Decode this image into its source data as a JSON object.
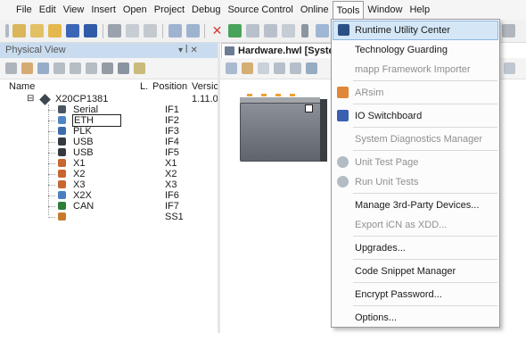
{
  "menu": {
    "items": [
      "File",
      "Edit",
      "View",
      "Insert",
      "Open",
      "Project",
      "Debug",
      "Source Control",
      "Online",
      "Tools",
      "Window",
      "Help"
    ],
    "active": "Tools"
  },
  "physical_view": {
    "title": "Physical View",
    "pin_glyph": "▾ ꟾ ✕",
    "columns": {
      "name": "Name",
      "l": "L.",
      "position": "Position",
      "version": "Versic"
    },
    "root": {
      "name": "X20CP1381",
      "version": "1.11.0",
      "expand_glyph": "⊟"
    },
    "rows": [
      {
        "name": "Serial",
        "position": "IF1",
        "icon": "serial-icon"
      },
      {
        "name": "ETH",
        "position": "IF2",
        "icon": "ethernet-icon",
        "selected": true
      },
      {
        "name": "PLK",
        "position": "IF3",
        "icon": "powerlink-icon"
      },
      {
        "name": "USB",
        "position": "IF4",
        "icon": "usb-icon"
      },
      {
        "name": "USB",
        "position": "IF5",
        "icon": "usb-icon"
      },
      {
        "name": "X1",
        "position": "X1",
        "icon": "connector-icon"
      },
      {
        "name": "X2",
        "position": "X2",
        "icon": "connector-icon"
      },
      {
        "name": "X3",
        "position": "X3",
        "icon": "connector-icon"
      },
      {
        "name": "X2X",
        "position": "IF6",
        "icon": "x2x-icon"
      },
      {
        "name": "CAN",
        "position": "IF7",
        "icon": "can-icon"
      },
      {
        "name": "",
        "position": "SS1",
        "icon": "slot-icon"
      }
    ]
  },
  "editor": {
    "tab_title": "Hardware.hwl [Syster"
  },
  "tools_menu": {
    "items": [
      {
        "label": "Runtime Utility Center",
        "enabled": true,
        "highlighted": true,
        "icon": "runtime-utility-icon"
      },
      {
        "label": "Technology Guarding",
        "enabled": true,
        "icon": ""
      },
      {
        "label": "mapp Framework Importer",
        "enabled": false,
        "icon": ""
      },
      {
        "sep": true
      },
      {
        "label": "ARsim",
        "enabled": false,
        "icon": "arsim-icon"
      },
      {
        "sep": true
      },
      {
        "label": "IO Switchboard",
        "enabled": true,
        "icon": "io-switchboard-icon"
      },
      {
        "sep": true
      },
      {
        "label": "System Diagnostics Manager",
        "enabled": false,
        "icon": ""
      },
      {
        "sep": true
      },
      {
        "label": "Unit Test Page",
        "enabled": false,
        "icon": "gear-icon"
      },
      {
        "label": "Run Unit Tests",
        "enabled": false,
        "icon": "gear-icon"
      },
      {
        "sep": true
      },
      {
        "label": "Manage 3rd-Party Devices...",
        "enabled": true,
        "icon": ""
      },
      {
        "label": "Export iCN as XDD...",
        "enabled": false,
        "icon": ""
      },
      {
        "sep": true
      },
      {
        "label": "Upgrades...",
        "enabled": true,
        "icon": ""
      },
      {
        "sep": true
      },
      {
        "label": "Code Snippet Manager",
        "enabled": true,
        "icon": ""
      },
      {
        "sep": true
      },
      {
        "label": "Encrypt Password...",
        "enabled": true,
        "icon": ""
      },
      {
        "sep": true
      },
      {
        "label": "Options...",
        "enabled": true,
        "icon": ""
      }
    ]
  },
  "colors": {
    "highlight": "#d5e7f7",
    "panel_header": "#c9dcef",
    "disabled_text": "#8f8f8f"
  }
}
